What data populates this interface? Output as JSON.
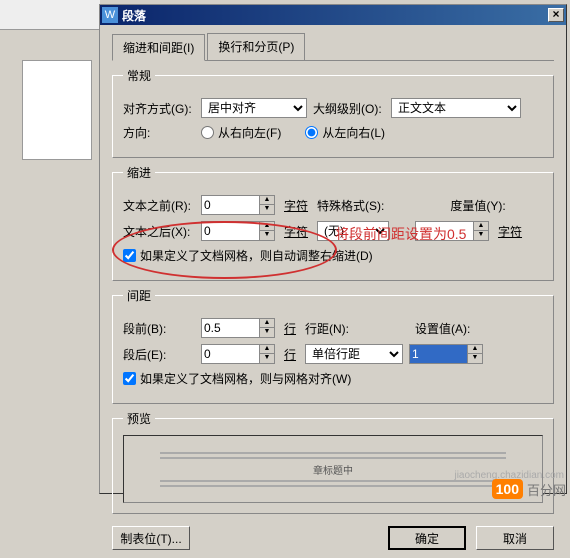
{
  "dialog": {
    "title": "段落",
    "close": "×",
    "tabs": {
      "tab1": "缩进和间距(I)",
      "tab2": "换行和分页(P)"
    }
  },
  "general": {
    "legend": "常规",
    "align_label": "对齐方式(G):",
    "align_value": "居中对齐",
    "outline_label": "大纲级别(O):",
    "outline_value": "正文文本",
    "direction_label": "方向:",
    "rtl_label": "从右向左(F)",
    "ltr_label": "从左向右(L)"
  },
  "indent": {
    "legend": "缩进",
    "before_label": "文本之前(R):",
    "before_value": "0",
    "after_label": "文本之后(X):",
    "after_value": "0",
    "unit": "字符",
    "special_label": "特殊格式(S):",
    "special_value": "(无)",
    "measure_label": "度量值(Y):",
    "measure_value": "",
    "measure_unit": "字符",
    "grid_check": "如果定义了文档网格，则自动调整右缩进(D)"
  },
  "spacing": {
    "legend": "间距",
    "before_label": "段前(B):",
    "before_value": "0.5",
    "after_label": "段后(E):",
    "after_value": "0",
    "unit": "行",
    "linespacing_label": "行距(N):",
    "linespacing_value": "单倍行距",
    "setvalue_label": "设置值(A):",
    "setvalue_value": "1",
    "grid_check": "如果定义了文档网格，则与网格对齐(W)"
  },
  "preview": {
    "legend": "预览",
    "mid_text": "章标题中"
  },
  "buttons": {
    "tabstops": "制表位(T)...",
    "ok": "确定",
    "cancel": "取消"
  },
  "annotation": {
    "text": "将段前间距设置为0.5"
  },
  "watermark": {
    "badge": "100",
    "text": "百分网",
    "sub": "jiaocheng.chazidian.com"
  }
}
